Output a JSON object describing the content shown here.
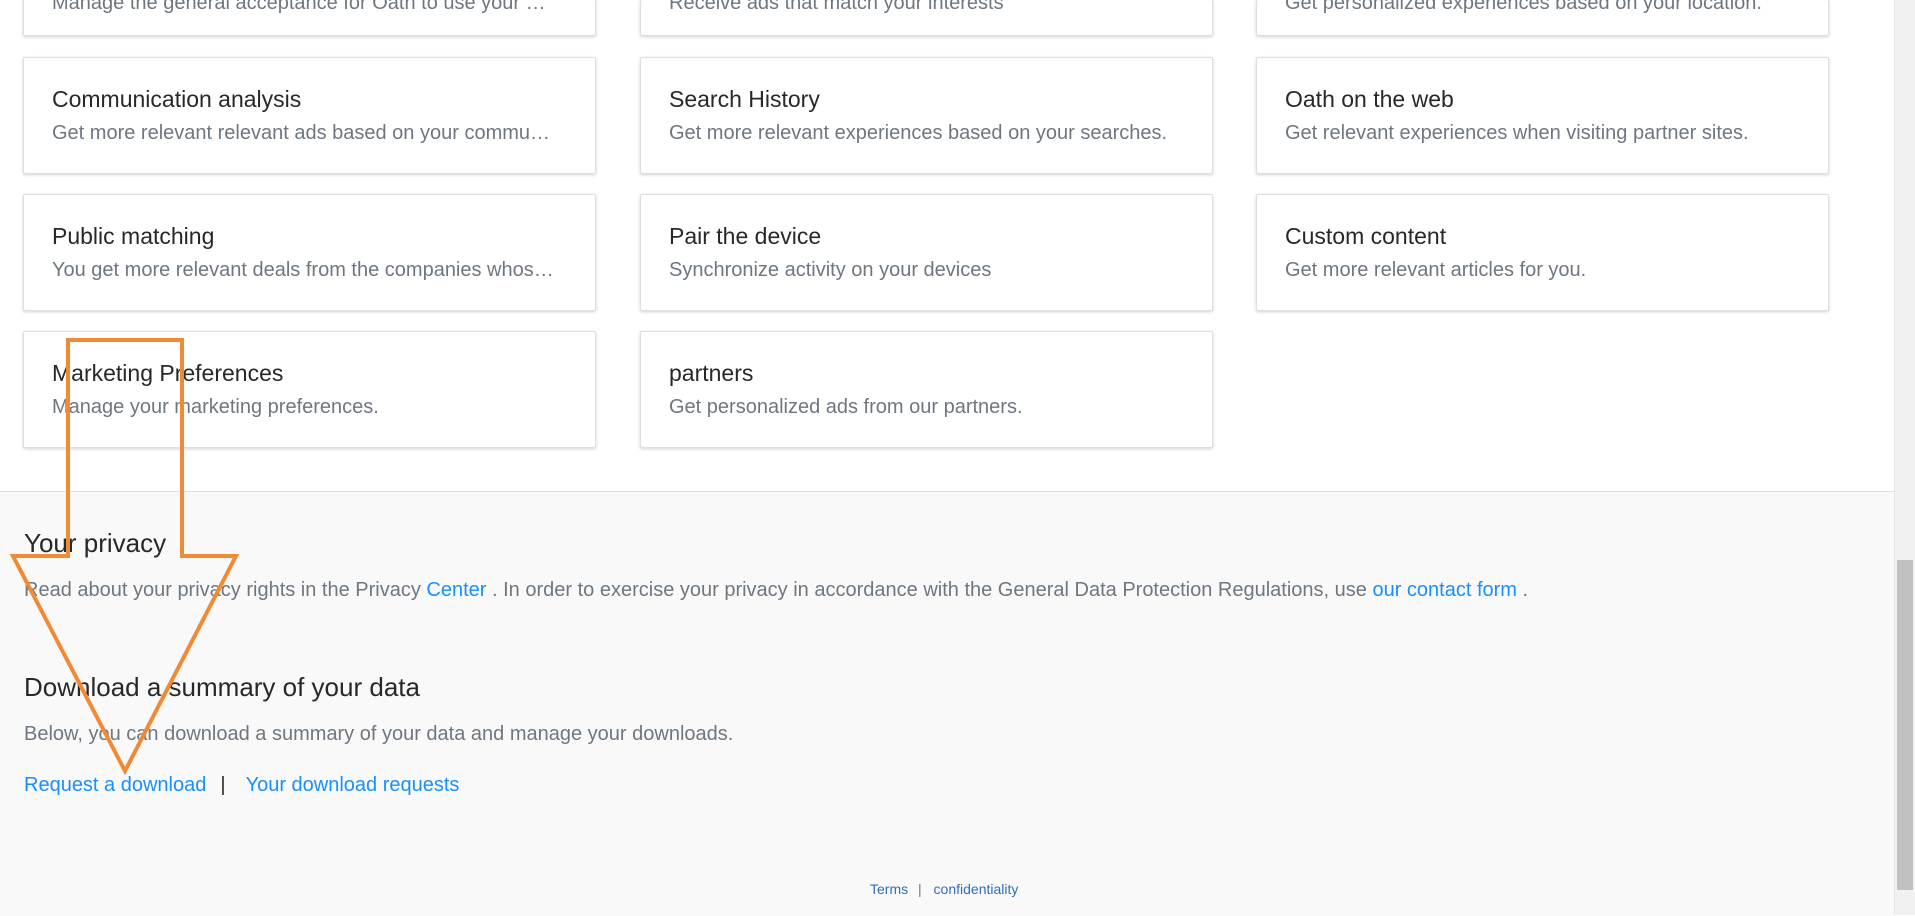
{
  "cards": {
    "top_partial": [
      {
        "desc": "Manage the general acceptance for Oath to use your …"
      },
      {
        "desc": "Receive ads that match your interests"
      },
      {
        "desc": "Get personalized experiences based on your location."
      }
    ],
    "items": [
      {
        "title": "Communication analysis",
        "desc": "Get more relevant relevant ads based on your commu…"
      },
      {
        "title": "Search History",
        "desc": "Get more relevant experiences based on your searches."
      },
      {
        "title": "Oath on the web",
        "desc": "Get relevant experiences when visiting partner sites."
      },
      {
        "title": "Public matching",
        "desc": "You get more relevant deals from the companies whos…"
      },
      {
        "title": "Pair the device",
        "desc": "Synchronize activity on your devices"
      },
      {
        "title": "Custom content",
        "desc": "Get more relevant articles for you."
      },
      {
        "title": "Marketing Preferences",
        "desc": "Manage your marketing preferences."
      },
      {
        "title": "partners",
        "desc": "Get personalized ads from our partners."
      }
    ]
  },
  "privacy": {
    "title": "Your privacy",
    "text_before": "Read about your privacy rights in the Privacy ",
    "center_link": "Center",
    "text_middle": " . In order to exercise your privacy in accordance with the General Data Protection Regulations, use ",
    "contact_link": "our contact form",
    "text_after": " ."
  },
  "download": {
    "title": "Download a summary of your data",
    "text": "Below, you can download a summary of your data and manage your downloads.",
    "request_link": "Request a download",
    "separator": "|",
    "requests_link": "Your download requests"
  },
  "legal": {
    "terms": "Terms",
    "separator": "|",
    "confidentiality": "confidentiality"
  },
  "colors": {
    "link": "#188fff",
    "annotation_arrow": "#f08a35",
    "footer_bg": "#f9f9f9"
  }
}
